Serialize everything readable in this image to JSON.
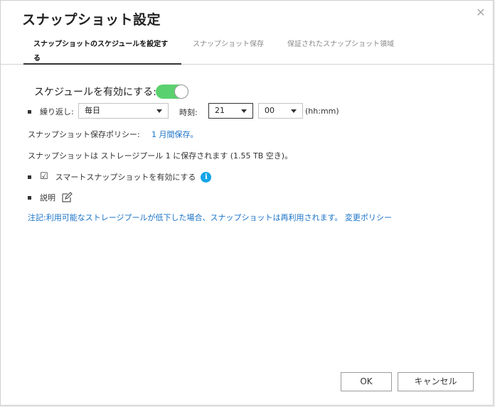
{
  "dialog": {
    "title": "スナップショット設定",
    "close_glyph": "✕"
  },
  "tabs": [
    {
      "label": "スナップショットのスケジュールを設定する"
    },
    {
      "label": "スナップショット保存"
    },
    {
      "label": "保証されたスナップショット領域"
    }
  ],
  "schedule": {
    "enable_label": "スケジュールを有効にする:",
    "enabled": true,
    "repeat_label": "繰り返し:",
    "repeat_value": "毎日",
    "time_label": "時刻:",
    "hour_value": "21",
    "minute_value": "00",
    "time_format": "(hh:mm)"
  },
  "retention": {
    "label": "スナップショット保存ポリシー:",
    "value": "1 月間保存。"
  },
  "storage_info": "スナップショットは ストレージプール 1 に保存されます (1.55 TB 空き)。",
  "smart_snapshot": {
    "checkbox_glyph": "☑",
    "label": "スマートスナップショットを有効にする",
    "info_glyph": "i"
  },
  "description": {
    "label": "説明"
  },
  "note": {
    "text": "注記:利用可能なストレージプールが低下した場合、スナップショットは再利用されます。",
    "link": "変更ポリシー"
  },
  "buttons": {
    "ok": "OK",
    "cancel": "キャンセル"
  },
  "colors": {
    "toggle_on": "#5ad16f",
    "link": "#1a73c7",
    "info": "#13a4e8"
  }
}
